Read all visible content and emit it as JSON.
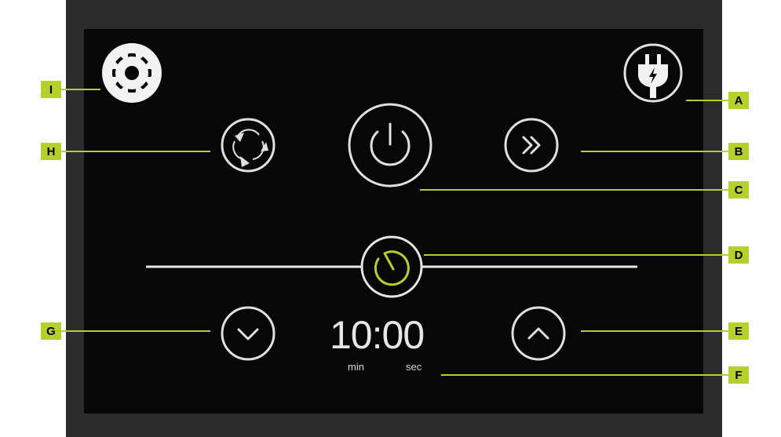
{
  "timer": {
    "display": "10:00",
    "unit_minutes": "min",
    "unit_seconds": "sec"
  },
  "slider": {
    "position_fraction": 0.5
  },
  "callouts": [
    {
      "id": "A",
      "label": "A",
      "target": "power-plug-button"
    },
    {
      "id": "B",
      "label": "B",
      "target": "skip-forward-button"
    },
    {
      "id": "C",
      "label": "C",
      "target": "power-button"
    },
    {
      "id": "D",
      "label": "D",
      "target": "timer-slider-knob"
    },
    {
      "id": "E",
      "label": "E",
      "target": "increase-button"
    },
    {
      "id": "F",
      "label": "F",
      "target": "time-display"
    },
    {
      "id": "G",
      "label": "G",
      "target": "decrease-button"
    },
    {
      "id": "H",
      "label": "H",
      "target": "cycle-mode-button"
    },
    {
      "id": "I",
      "label": "I",
      "target": "settings-button"
    }
  ],
  "icons": {
    "settings": "gear-icon",
    "plug": "power-plug-icon",
    "power": "power-icon",
    "skip": "double-chevron-right-icon",
    "cycle": "rotate-arrows-icon",
    "timer": "timer-icon",
    "up": "chevron-up-icon",
    "down": "chevron-down-icon"
  },
  "colors": {
    "accent": "#b5cf2c",
    "screen_bg": "#070707",
    "frame": "#2b2b2b",
    "control_stroke": "#e0e0e0"
  }
}
